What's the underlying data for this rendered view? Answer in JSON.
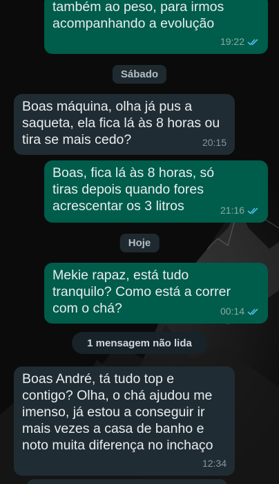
{
  "colors": {
    "background": "#0b0b0b",
    "outgoing_bubble": "#005c4b",
    "incoming_bubble": "#202c33",
    "read_ticks": "#53bdeb"
  },
  "messages": [
    {
      "direction": "outgoing",
      "text": "também ao peso, para irmos\nacompanhando a evolução",
      "time": "19:22",
      "status": "read"
    },
    {
      "direction": "incoming",
      "text": "Boas máquina, olha já pus a\nsaqueta, ela fica lá às 8 horas ou\ntira se mais cedo?",
      "time": "20:15"
    },
    {
      "direction": "outgoing",
      "text": "Boas, fica lá às 8 horas, só\ntiras depois quando fores\nacrescentar os 3 litros",
      "time": "21:16",
      "status": "read"
    },
    {
      "direction": "outgoing",
      "text": "Mekie rapaz, está tudo\ntranquilo? Como está a correr\ncom o chá?",
      "time": "00:14",
      "status": "read"
    },
    {
      "direction": "incoming",
      "text": "Boas André, tá tudo top e\ncontigo? Olha, o chá ajudou me\nimenso, já estou a conseguir ir\nmais vezes a casa de banho e\nnoto muita diferença no inchaço",
      "time": "12:34"
    }
  ],
  "date_separators": [
    "Sábado",
    "Hoje"
  ],
  "unread_banner": "1 mensagem não lida",
  "icons": [
    "double-check-icon"
  ]
}
